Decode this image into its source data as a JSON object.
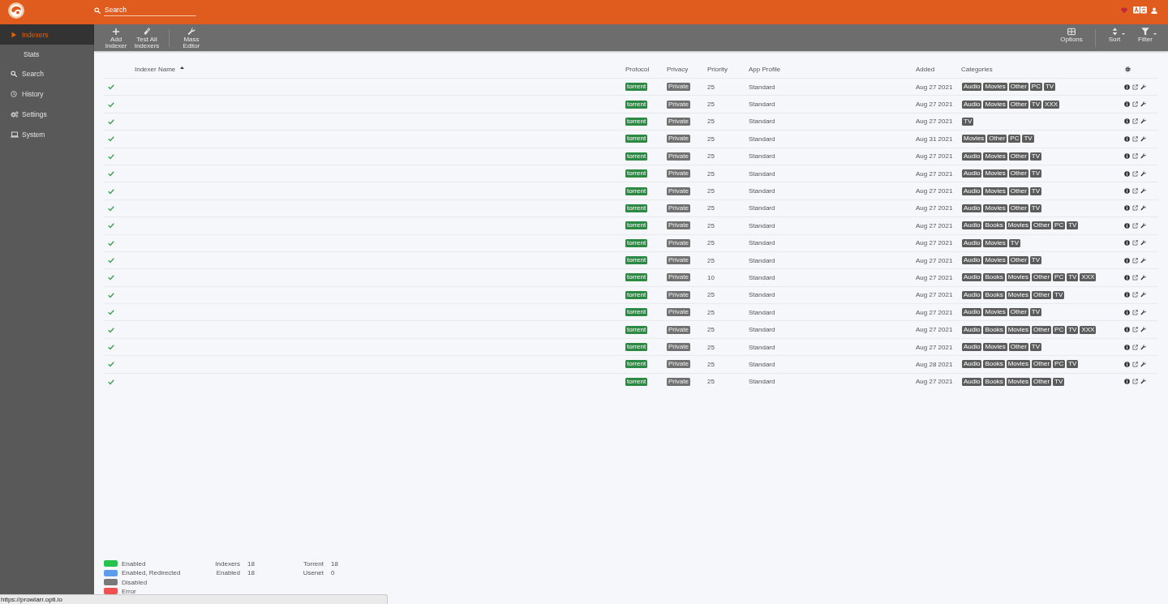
{
  "header": {
    "search": {
      "placeholder": "Search"
    }
  },
  "sidebar": {
    "items": [
      {
        "label": "Indexers",
        "selected": true,
        "children": [
          {
            "label": "Stats",
            "selected": false
          }
        ]
      },
      {
        "label": "Search",
        "selected": false
      },
      {
        "label": "History",
        "selected": false
      },
      {
        "label": "Settings",
        "selected": false
      },
      {
        "label": "System",
        "selected": false
      }
    ]
  },
  "toolbar": {
    "left_groups": [
      [
        {
          "label": "Add\nIndexer",
          "has_menu": false
        },
        {
          "label": "Test All\nIndexers",
          "has_menu": false
        }
      ],
      [
        {
          "label": "Mass\nEditor",
          "has_menu": false
        }
      ]
    ],
    "right_groups": [
      [
        {
          "label": "Options",
          "has_menu": false
        }
      ],
      [
        {
          "label": "Sort",
          "has_menu": true
        },
        {
          "label": "Filter",
          "has_menu": true
        }
      ]
    ]
  },
  "table": {
    "columns": [
      {
        "label": "Indexer Name",
        "sorted": true
      },
      {
        "label": "Protocol",
        "sorted": false
      },
      {
        "label": "Privacy",
        "sorted": false
      },
      {
        "label": "Priority",
        "sorted": false
      },
      {
        "label": "App Profile",
        "sorted": false
      },
      {
        "label": "Added",
        "sorted": false
      },
      {
        "label": "Categories",
        "sorted": false
      }
    ],
    "rows": [
      {
        "enabled": true,
        "protocol": "torrent",
        "privacy": "Private",
        "priority": "25",
        "app_profile": "Standard",
        "added": "Aug 27 2021",
        "categories": [
          "Audio",
          "Movies",
          "Other",
          "PC",
          "TV"
        ]
      },
      {
        "enabled": true,
        "protocol": "torrent",
        "privacy": "Private",
        "priority": "25",
        "app_profile": "Standard",
        "added": "Aug 27 2021",
        "categories": [
          "Audio",
          "Movies",
          "Other",
          "TV",
          "XXX"
        ]
      },
      {
        "enabled": true,
        "protocol": "torrent",
        "privacy": "Private",
        "priority": "25",
        "app_profile": "Standard",
        "added": "Aug 27 2021",
        "categories": [
          "TV"
        ]
      },
      {
        "enabled": true,
        "protocol": "torrent",
        "privacy": "Private",
        "priority": "25",
        "app_profile": "Standard",
        "added": "Aug 31 2021",
        "categories": [
          "Movies",
          "Other",
          "PC",
          "TV"
        ]
      },
      {
        "enabled": true,
        "protocol": "torrent",
        "privacy": "Private",
        "priority": "25",
        "app_profile": "Standard",
        "added": "Aug 27 2021",
        "categories": [
          "Audio",
          "Movies",
          "Other",
          "TV"
        ]
      },
      {
        "enabled": true,
        "protocol": "torrent",
        "privacy": "Private",
        "priority": "25",
        "app_profile": "Standard",
        "added": "Aug 27 2021",
        "categories": [
          "Audio",
          "Movies",
          "Other",
          "TV"
        ]
      },
      {
        "enabled": true,
        "protocol": "torrent",
        "privacy": "Private",
        "priority": "25",
        "app_profile": "Standard",
        "added": "Aug 27 2021",
        "categories": [
          "Audio",
          "Movies",
          "Other",
          "TV"
        ]
      },
      {
        "enabled": true,
        "protocol": "torrent",
        "privacy": "Private",
        "priority": "25",
        "app_profile": "Standard",
        "added": "Aug 27 2021",
        "categories": [
          "Audio",
          "Movies",
          "Other",
          "TV"
        ]
      },
      {
        "enabled": true,
        "protocol": "torrent",
        "privacy": "Private",
        "priority": "25",
        "app_profile": "Standard",
        "added": "Aug 27 2021",
        "categories": [
          "Audio",
          "Books",
          "Movies",
          "Other",
          "PC",
          "TV"
        ]
      },
      {
        "enabled": true,
        "protocol": "torrent",
        "privacy": "Private",
        "priority": "25",
        "app_profile": "Standard",
        "added": "Aug 27 2021",
        "categories": [
          "Audio",
          "Movies",
          "TV"
        ]
      },
      {
        "enabled": true,
        "protocol": "torrent",
        "privacy": "Private",
        "priority": "25",
        "app_profile": "Standard",
        "added": "Aug 27 2021",
        "categories": [
          "Audio",
          "Movies",
          "Other",
          "TV"
        ]
      },
      {
        "enabled": true,
        "protocol": "torrent",
        "privacy": "Private",
        "priority": "10",
        "app_profile": "Standard",
        "added": "Aug 27 2021",
        "categories": [
          "Audio",
          "Books",
          "Movies",
          "Other",
          "PC",
          "TV",
          "XXX"
        ]
      },
      {
        "enabled": true,
        "protocol": "torrent",
        "privacy": "Private",
        "priority": "25",
        "app_profile": "Standard",
        "added": "Aug 27 2021",
        "categories": [
          "Audio",
          "Books",
          "Movies",
          "Other",
          "TV"
        ]
      },
      {
        "enabled": true,
        "protocol": "torrent",
        "privacy": "Private",
        "priority": "25",
        "app_profile": "Standard",
        "added": "Aug 27 2021",
        "categories": [
          "Audio",
          "Movies",
          "Other",
          "TV"
        ]
      },
      {
        "enabled": true,
        "protocol": "torrent",
        "privacy": "Private",
        "priority": "25",
        "app_profile": "Standard",
        "added": "Aug 27 2021",
        "categories": [
          "Audio",
          "Books",
          "Movies",
          "Other",
          "PC",
          "TV",
          "XXX"
        ]
      },
      {
        "enabled": true,
        "protocol": "torrent",
        "privacy": "Private",
        "priority": "25",
        "app_profile": "Standard",
        "added": "Aug 27 2021",
        "categories": [
          "Audio",
          "Movies",
          "Other",
          "TV"
        ]
      },
      {
        "enabled": true,
        "protocol": "torrent",
        "privacy": "Private",
        "priority": "25",
        "app_profile": "Standard",
        "added": "Aug 28 2021",
        "categories": [
          "Audio",
          "Books",
          "Movies",
          "Other",
          "PC",
          "TV"
        ]
      },
      {
        "enabled": true,
        "protocol": "torrent",
        "privacy": "Private",
        "priority": "25",
        "app_profile": "Standard",
        "added": "Aug 27 2021",
        "categories": [
          "Audio",
          "Books",
          "Movies",
          "Other",
          "TV"
        ]
      }
    ]
  },
  "footer": {
    "legend": [
      {
        "label": "Enabled",
        "color": "#27c24c"
      },
      {
        "label": "Enabled, Redirected",
        "color": "#5d9cec"
      },
      {
        "label": "Disabled",
        "color": "#797979"
      },
      {
        "label": "Error",
        "color": "#f05050"
      }
    ],
    "stats": [
      [
        {
          "label": "Indexers",
          "value": "18"
        },
        {
          "label": "Enabled",
          "value": "18"
        }
      ],
      [
        {
          "label": "Torrent",
          "value": "18"
        },
        {
          "label": "Usenet",
          "value": "0"
        }
      ]
    ]
  },
  "link_preview": {
    "url": "https://prowlarr.opti.io"
  }
}
